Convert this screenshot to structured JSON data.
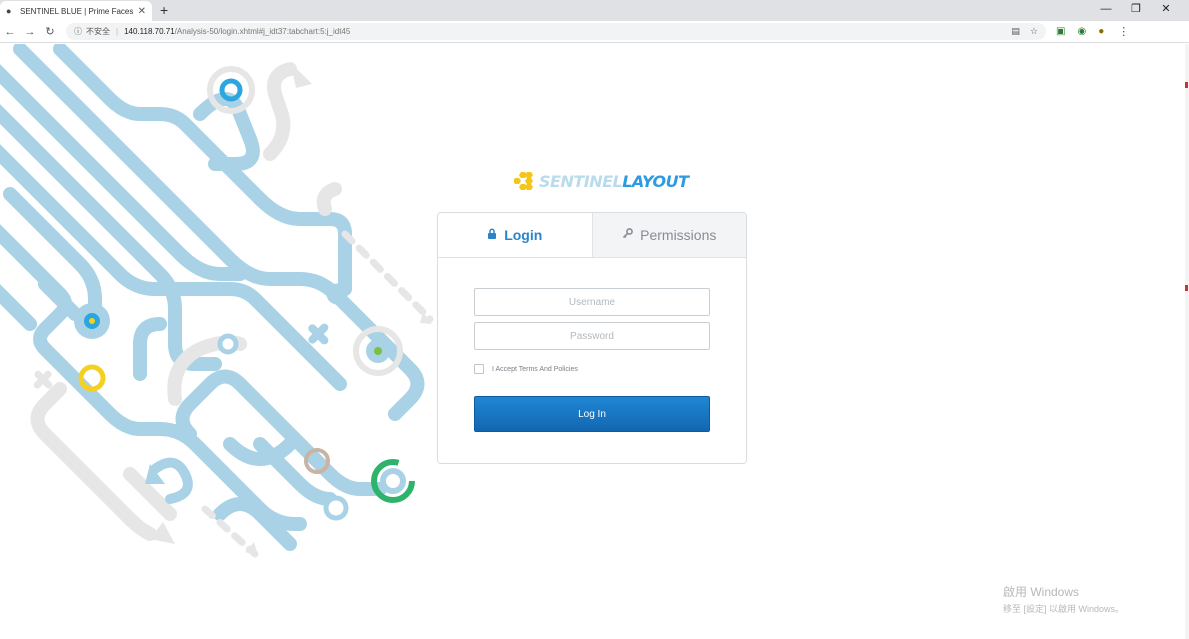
{
  "browser": {
    "tab_title": "SENTINEL BLUE | Prime Faces L",
    "new_tab": "+",
    "url_security": "不安全",
    "url_host": "140.118.70.71",
    "url_path": "/Analysis-50/login.xhtml#j_idt37:tabchart:5:j_idt45"
  },
  "logo": {
    "part1": "SENTINEL",
    "part2": "LAYOUT"
  },
  "tabs": {
    "login": "Login",
    "permissions": "Permissions"
  },
  "form": {
    "username_placeholder": "Username",
    "password_placeholder": "Password",
    "terms_label": "I Accept Terms And Policies",
    "login_button": "Log In"
  },
  "watermark": {
    "line1": "啟用 Windows",
    "line2": "移至 [設定] 以啟用 Windows。"
  },
  "colors": {
    "accent": "#2b84c6",
    "button": "#1367b0",
    "logo_light": "#b9dcec",
    "logo_dark": "#2d9be0",
    "decor_blue": "#a9d2e6",
    "decor_gray": "#e4e4e4"
  }
}
